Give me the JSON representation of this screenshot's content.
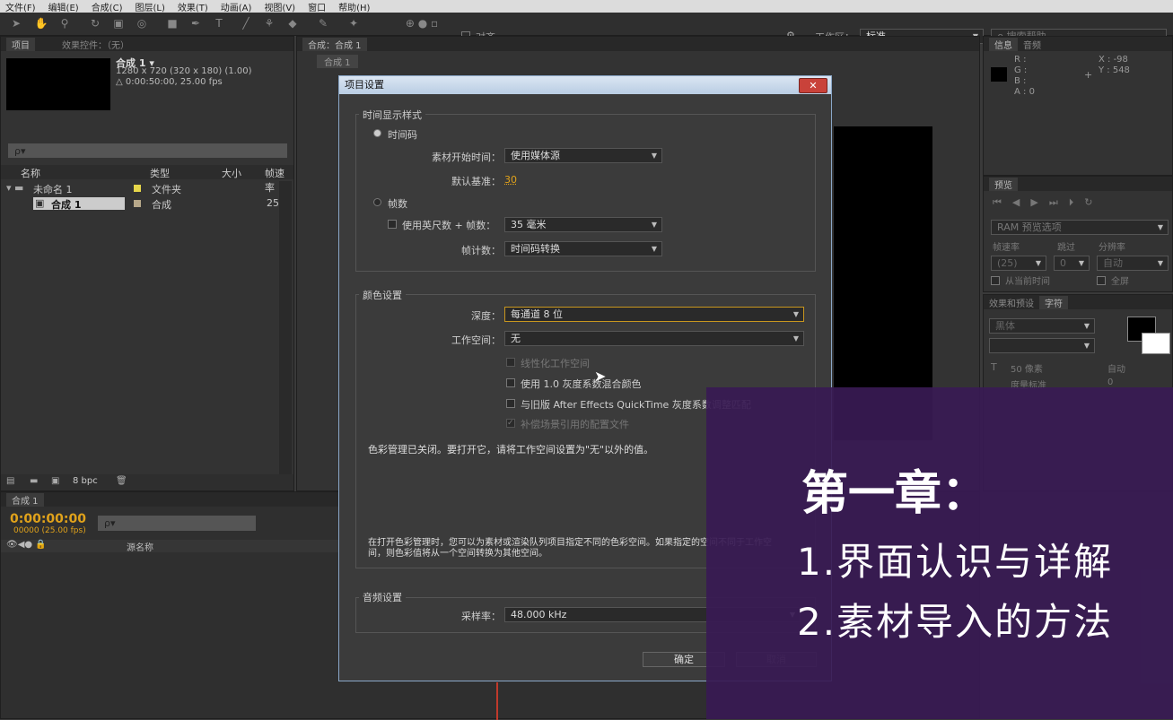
{
  "menu": [
    "文件(F)",
    "编辑(E)",
    "合成(C)",
    "图层(L)",
    "效果(T)",
    "动画(A)",
    "视图(V)",
    "窗口",
    "帮助(H)"
  ],
  "toolbar": {
    "snap_label": "对齐",
    "workspace_label": "工作区：",
    "workspace_value": "标准",
    "search_placeholder": "搜索帮助"
  },
  "project_panel": {
    "tab_project": "项目",
    "tab_effects": "效果控件：（无）",
    "comp_name": "合成 1 ▾",
    "comp_size": "1280 x 720  (320 x 180) (1.00)",
    "comp_duration": "△ 0:00:50:00, 25.00 fps",
    "search_placeholder": "ρ▾",
    "columns": [
      "名称",
      "类型",
      "大小",
      "帧速率"
    ],
    "items": [
      {
        "name": "未命名 1",
        "type": "文件夹",
        "size": ""
      },
      {
        "name": "合成 1",
        "type": "合成",
        "size": "25"
      }
    ],
    "bpc": "8 bpc"
  },
  "comp_panel": {
    "tab": "合成：合成 1",
    "subtab": "合成 1"
  },
  "info_panel": {
    "tab_info": "信息",
    "tab_audio": "音频",
    "r": "R :",
    "g": "G :",
    "b": "B :",
    "a": "A : 0",
    "x": "X : -98",
    "y": "Y : 548"
  },
  "preview_panel": {
    "tab": "预览",
    "ram": "RAM 预览选项",
    "frame_rate_label": "帧速率",
    "skip_label": "跳过",
    "resolution_label": "分辨率",
    "frame_rate": "(25)",
    "skip": "0",
    "resolution": "自动",
    "from_current": "从当前时间",
    "fullscreen": "全屏"
  },
  "char_panel": {
    "tab_effects": "效果和预设",
    "tab_char": "字符",
    "font": "黑体",
    "size": "50 像素",
    "auto": "自动",
    "metric": "度量标准",
    "zero": "0"
  },
  "timeline": {
    "tab": "合成 1",
    "timecode": "0:00:00:00",
    "frames": "00000 (25.00 fps)",
    "source_col": "源名称"
  },
  "dialog": {
    "title": "项目设置",
    "time_group": "时间显示样式",
    "timecode_radio": "时间码",
    "footage_start_label": "素材开始时间：",
    "footage_start_value": "使用媒体源",
    "default_base_label": "默认基准：",
    "default_base_value": "30",
    "frames_radio": "帧数",
    "feet_frames_label": "使用英尺数 + 帧数：",
    "feet_frames_value": "35 毫米",
    "frame_count_label": "帧计数：",
    "frame_count_value": "时间码转换",
    "color_group": "颜色设置",
    "depth_label": "深度：",
    "depth_value": "每通道 8 位",
    "working_space_label": "工作空间：",
    "working_space_value": "无",
    "linearize": "线性化工作空间",
    "blend_gamma": "使用 1.0 灰度系数混合颜色",
    "match_legacy": "与旧版 After Effects QuickTime 灰度系数调整匹配",
    "compensate": "补偿场景引用的配置文件",
    "color_note": "色彩管理已关闭。要打开它，请将工作空间设置为\"无\"以外的值。",
    "color_info": "在打开色彩管理时，您可以为素材或渲染队列项目指定不同的色彩空间。如果指定的空间不同于工作空间，则色彩值将从一个空间转换为其他空间。",
    "audio_group": "音频设置",
    "sample_rate_label": "采样率：",
    "sample_rate_value": "48.000 kHz",
    "ok": "确定",
    "cancel": "取消",
    "close": "✕"
  },
  "overlay": {
    "title": "第一章：",
    "line1": "1.界面认识与详解",
    "line2": "2.素材导入的方法"
  }
}
